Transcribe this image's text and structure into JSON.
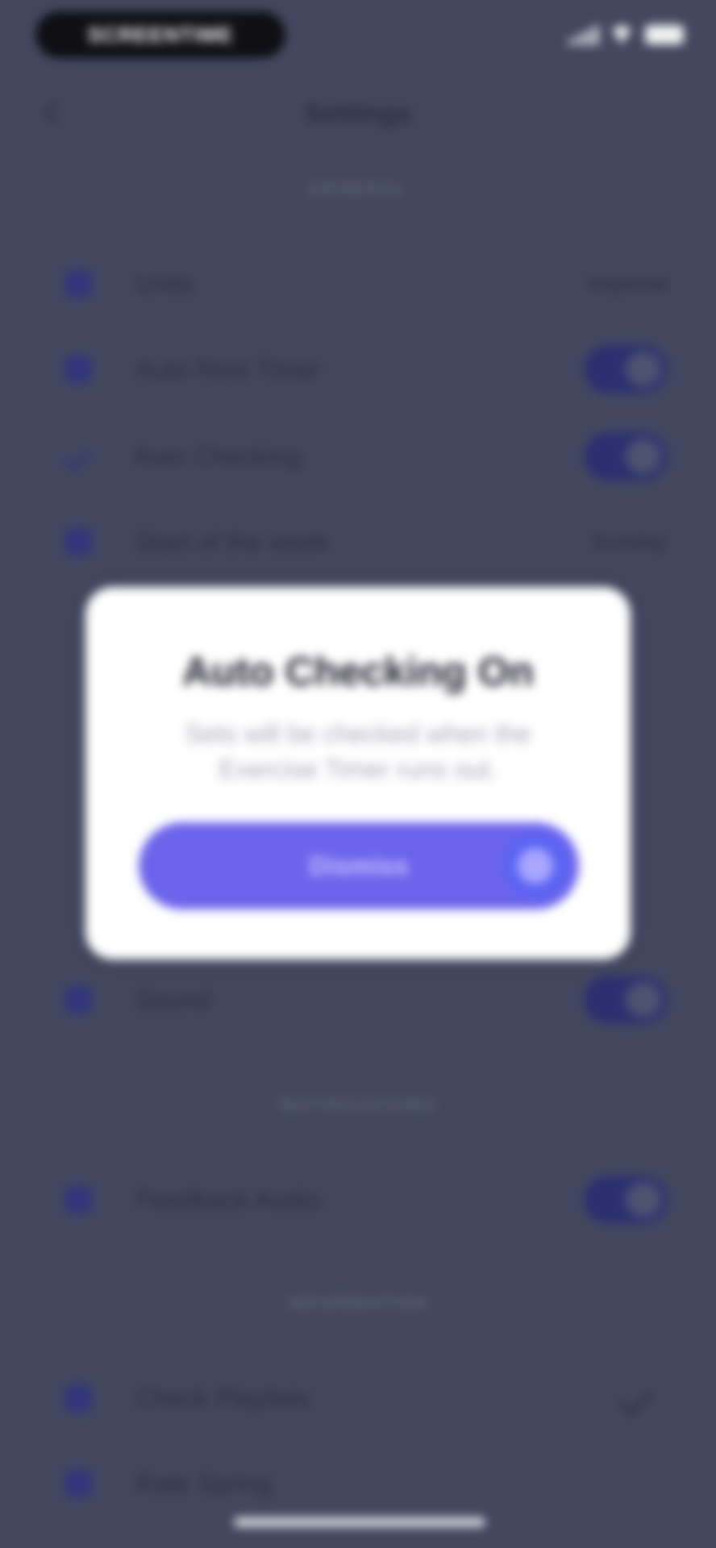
{
  "status_bar": {
    "pill_text": "SCREENTIME",
    "icons": [
      "signal-icon",
      "wifi-icon",
      "battery-icon"
    ]
  },
  "header": {
    "title": "Settings"
  },
  "sections": [
    {
      "label": "GENERAL"
    },
    {
      "label": "NOTIFICATIONS"
    },
    {
      "label": "INFORMATION"
    }
  ],
  "rows": [
    {
      "label": "Units",
      "value": "Imperial",
      "control": "value"
    },
    {
      "label": "Auto Rest Timer",
      "control": "toggle",
      "on": true
    },
    {
      "label": "Auto Checking",
      "control": "toggle",
      "on": true
    },
    {
      "label": "Start of the week",
      "value": "Sunday",
      "control": "value"
    },
    {
      "label": "Sound",
      "control": "toggle",
      "on": true
    },
    {
      "label": "Feedback Audio",
      "control": "toggle",
      "on": true
    },
    {
      "label": "Check Playlists",
      "control": "check"
    },
    {
      "label": "Rate Spring",
      "control": "none"
    }
  ],
  "modal": {
    "title": "Auto Checking On",
    "text": "Sets will be checked when the Exercise Timer runs out.",
    "button_label": "Dismiss"
  },
  "colors": {
    "overlay_bg": "#434860",
    "accent": "#6c63ec",
    "toggle_on": "#2c3070"
  }
}
